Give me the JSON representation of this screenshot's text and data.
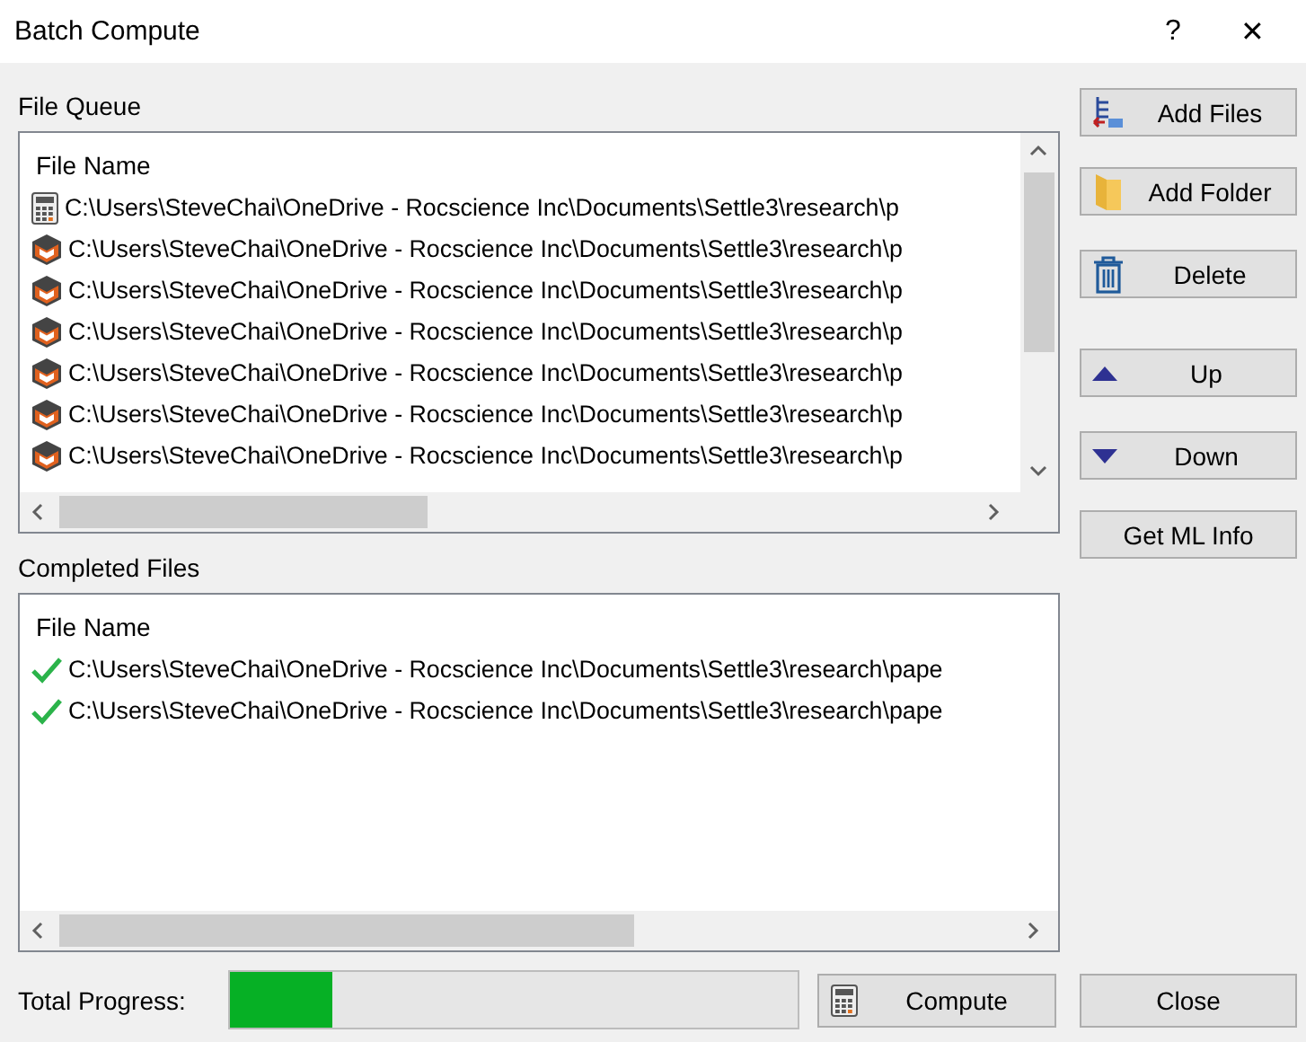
{
  "window": {
    "title": "Batch Compute",
    "help": "?",
    "close": "✕"
  },
  "file_queue": {
    "label": "File Queue",
    "column": "File Name",
    "rows": [
      {
        "kind": "calculator",
        "path": "C:\\Users\\SteveChai\\OneDrive - Rocscience Inc\\Documents\\Settle3\\research\\p"
      },
      {
        "kind": "model",
        "path": "C:\\Users\\SteveChai\\OneDrive - Rocscience Inc\\Documents\\Settle3\\research\\p"
      },
      {
        "kind": "model",
        "path": "C:\\Users\\SteveChai\\OneDrive - Rocscience Inc\\Documents\\Settle3\\research\\p"
      },
      {
        "kind": "model",
        "path": "C:\\Users\\SteveChai\\OneDrive - Rocscience Inc\\Documents\\Settle3\\research\\p"
      },
      {
        "kind": "model",
        "path": "C:\\Users\\SteveChai\\OneDrive - Rocscience Inc\\Documents\\Settle3\\research\\p"
      },
      {
        "kind": "model",
        "path": "C:\\Users\\SteveChai\\OneDrive - Rocscience Inc\\Documents\\Settle3\\research\\p"
      },
      {
        "kind": "model",
        "path": "C:\\Users\\SteveChai\\OneDrive - Rocscience Inc\\Documents\\Settle3\\research\\p"
      }
    ]
  },
  "completed_files": {
    "label": "Completed Files",
    "column": "File Name",
    "rows": [
      {
        "kind": "done",
        "path": "C:\\Users\\SteveChai\\OneDrive - Rocscience Inc\\Documents\\Settle3\\research\\pape"
      },
      {
        "kind": "done",
        "path": "C:\\Users\\SteveChai\\OneDrive - Rocscience Inc\\Documents\\Settle3\\research\\pape"
      }
    ]
  },
  "side_buttons": [
    {
      "kind": "add-files",
      "label": "Add Files"
    },
    {
      "kind": "add-folder",
      "label": "Add Folder"
    },
    {
      "kind": "delete",
      "label": "Delete"
    },
    {
      "kind": "up",
      "label": "Up"
    },
    {
      "kind": "down",
      "label": "Down"
    },
    {
      "kind": "plain",
      "label": "Get ML Info"
    }
  ],
  "footer": {
    "progress_label": "Total Progress:",
    "level": 0.18,
    "compute": "Compute",
    "close": "Close"
  }
}
